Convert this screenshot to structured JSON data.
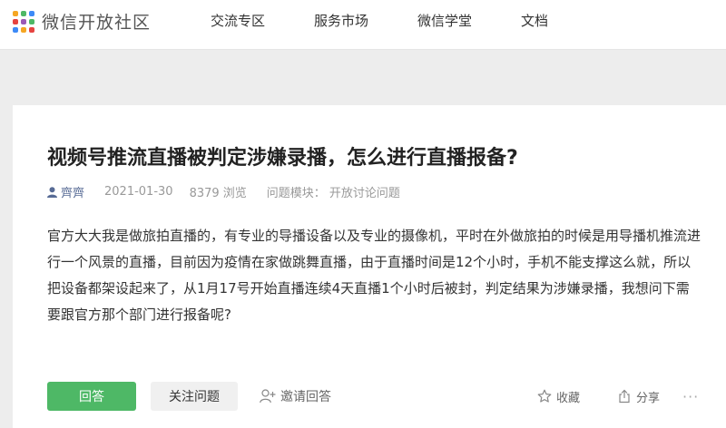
{
  "header": {
    "site_title": "微信开放社区",
    "nav": [
      {
        "label": "交流专区"
      },
      {
        "label": "服务市场"
      },
      {
        "label": "微信学堂"
      },
      {
        "label": "文档"
      }
    ]
  },
  "question": {
    "title": "视频号推流直播被判定涉嫌录播，怎么进行直播报备?",
    "author": "齊齊",
    "date": "2021-01-30",
    "views": "8379 浏览",
    "module": "问题模块：  开放讨论问题",
    "body": "官方大大我是做旅拍直播的，有专业的导播设备以及专业的摄像机，平时在外做旅拍的时候是用导播机推流进行一个风景的直播，目前因为疫情在家做跳舞直播，由于直播时间是12个小时，手机不能支撑这么就，所以把设备都架设起来了，从1月17号开始直播连续4天直播1个小时后被封，判定结果为涉嫌录播，我想问下需要跟官方那个部门进行报备呢?"
  },
  "actions": {
    "answer_label": "回答",
    "follow_label": "关注问题",
    "invite_label": "邀请回答",
    "favorite_label": "收藏",
    "share_label": "分享",
    "more_label": "···"
  },
  "colors": {
    "accent": "#4eb866",
    "author": "#576b95"
  }
}
